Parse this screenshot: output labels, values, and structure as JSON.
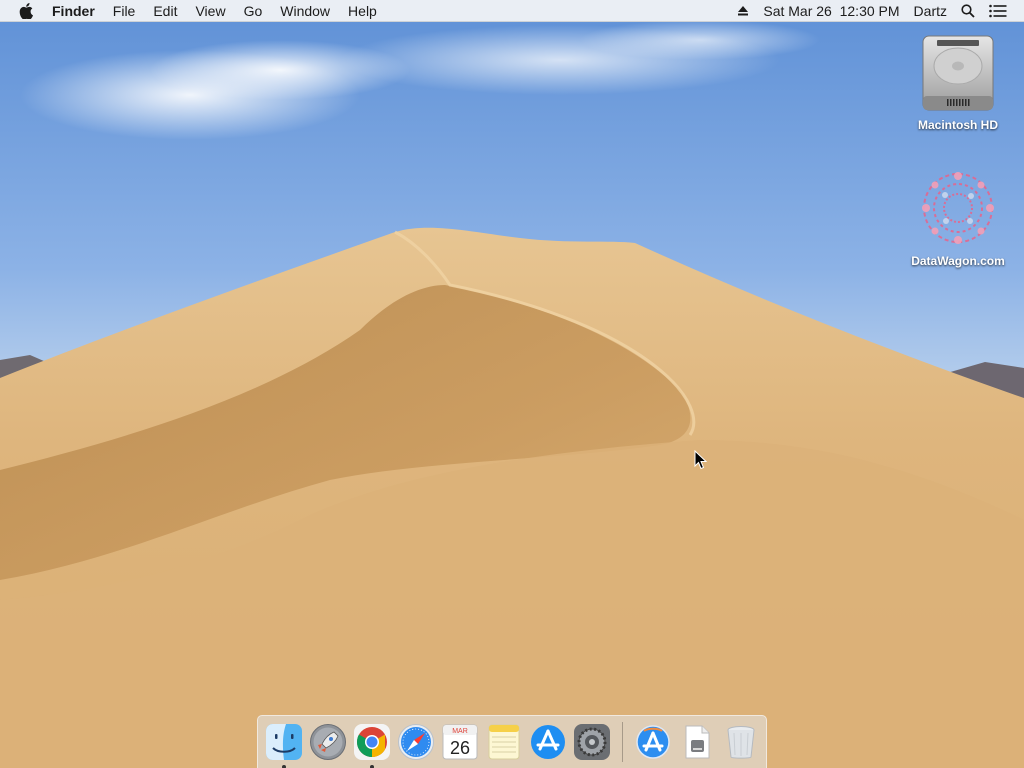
{
  "menubar": {
    "apple_icon": "apple-logo-icon",
    "app_name": "Finder",
    "menus": [
      "File",
      "Edit",
      "View",
      "Go",
      "Window",
      "Help"
    ],
    "status": {
      "eject_icon": "eject-icon",
      "datetime": "Sat Mar 26  12:30 PM",
      "user": "Dartz",
      "search_icon": "spotlight-search-icon",
      "notifications_icon": "notification-center-icon"
    }
  },
  "desktop_icons": [
    {
      "label": "Macintosh HD",
      "icon": "hard-drive-icon"
    },
    {
      "label": "DataWagon.com",
      "icon": "disk-image-icon"
    }
  ],
  "dock": {
    "apps": [
      {
        "name": "Finder",
        "icon": "finder-icon",
        "running": true
      },
      {
        "name": "Launchpad",
        "icon": "launchpad-icon",
        "running": false
      },
      {
        "name": "Google Chrome",
        "icon": "chrome-icon",
        "running": true
      },
      {
        "name": "Safari",
        "icon": "safari-icon",
        "running": false
      },
      {
        "name": "Calendar",
        "icon": "calendar-icon",
        "running": false,
        "month": "MAR",
        "day": "26"
      },
      {
        "name": "Notes",
        "icon": "notes-icon",
        "running": false
      },
      {
        "name": "App Store",
        "icon": "app-store-icon",
        "running": false
      },
      {
        "name": "System Preferences",
        "icon": "system-preferences-icon",
        "running": false
      }
    ],
    "others": [
      {
        "name": "Applications",
        "icon": "applications-folder-icon"
      },
      {
        "name": "Document",
        "icon": "document-icon"
      },
      {
        "name": "Trash",
        "icon": "trash-icon"
      }
    ]
  },
  "colors": {
    "sky": "#80abe3",
    "sand": "#d9b27a",
    "menubar": "#f6f6f6"
  }
}
